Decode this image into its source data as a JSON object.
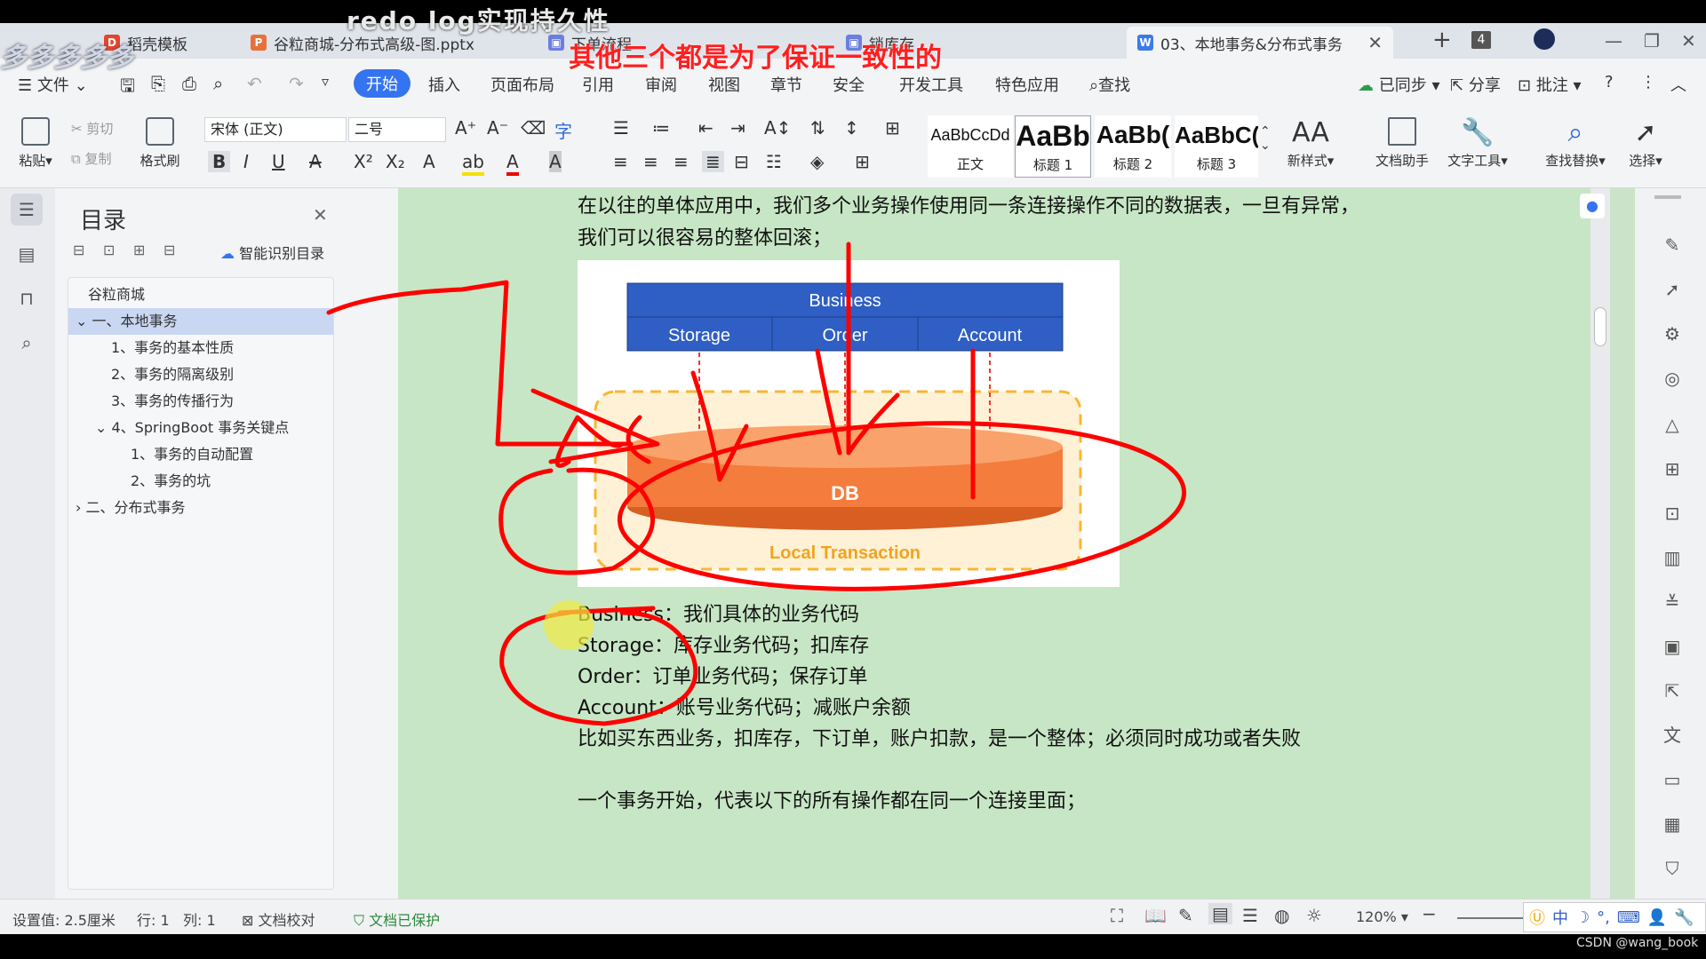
{
  "overlay": {
    "top_title": "redo  log实现持久性",
    "annotation": "其他三个都是为了保证一致性的",
    "scribble_text": "多多多多多"
  },
  "tabs": [
    {
      "label": "稻壳模板",
      "icon": "docer-icon"
    },
    {
      "label": "谷粒商城-分布式高级-图.pptx",
      "icon": "ppt-icon"
    },
    {
      "label": "下单流程",
      "icon": "whiteboard-icon"
    },
    {
      "label": "锁库存",
      "icon": "whiteboard-icon"
    },
    {
      "label": "03、本地事务&分布式事务",
      "icon": "word-icon"
    }
  ],
  "tab_count_badge": "4",
  "menu": {
    "file": "文件",
    "items": [
      "开始",
      "插入",
      "页面布局",
      "引用",
      "审阅",
      "视图",
      "章节",
      "安全",
      "开发工具",
      "特色应用"
    ],
    "search": "查找",
    "synced": "已同步",
    "share": "分享",
    "annotate": "批注"
  },
  "ribbon": {
    "paste": "粘贴",
    "cut": "剪切",
    "copy": "复制",
    "format_painter": "格式刷",
    "font_name": "宋体 (正文)",
    "font_size": "二号",
    "styles": [
      {
        "sample": "AaBbCcDd",
        "label": "正文"
      },
      {
        "sample": "AaBb",
        "label": "标题 1"
      },
      {
        "sample": "AaBb(",
        "label": "标题 2"
      },
      {
        "sample": "AaBbC(",
        "label": "标题 3"
      }
    ],
    "new_style": "新样式",
    "doc_assistant": "文档助手",
    "text_tools": "文字工具",
    "find_replace": "查找替换",
    "select": "选择"
  },
  "toc": {
    "title": "目录",
    "smart_toc": "智能识别目录",
    "items": [
      "谷粒商城",
      "一、本地事务",
      "1、事务的基本性质",
      "2、事务的隔离级别",
      "3、事务的传播行为",
      "4、SpringBoot 事务关键点",
      "1、事务的自动配置",
      "2、事务的坑",
      "二、分布式事务"
    ]
  },
  "doc": {
    "para1_line1": "在以往的单体应用中，我们多个业务操作使用同一条连接操作不同的数据表，一旦有异常，",
    "para1_line2": "我们可以很容易的整体回滚；",
    "lines": [
      "Business：我们具体的业务代码",
      "Storage：库存业务代码；扣库存",
      "Order：订单业务代码；保存订单",
      "Account：账号业务代码；减账户余额",
      "比如买东西业务，扣库存，下订单，账户扣款，是一个整体；必须同时成功或者失败",
      "一个事务开始，代表以下的所有操作都在同一个连接里面；"
    ]
  },
  "diagram": {
    "business": "Business",
    "storage": "Storage",
    "order": "Order",
    "account": "Account",
    "db": "DB",
    "local_tx": "Local Transaction"
  },
  "status": {
    "setting": "设置值: 2.5厘米",
    "row": "行: 1",
    "col": "列: 1",
    "proofread": "文档校对",
    "protected": "文档已保护",
    "zoom": "120%"
  },
  "ime": "中",
  "watermark": "CSDN @wang_book",
  "colors": {
    "accent": "#3574f0",
    "business_blue": "#2f5fc4",
    "db_orange": "#f47c3c",
    "annotation_red": "#ff0000",
    "doc_green": "#c7e6c5"
  }
}
